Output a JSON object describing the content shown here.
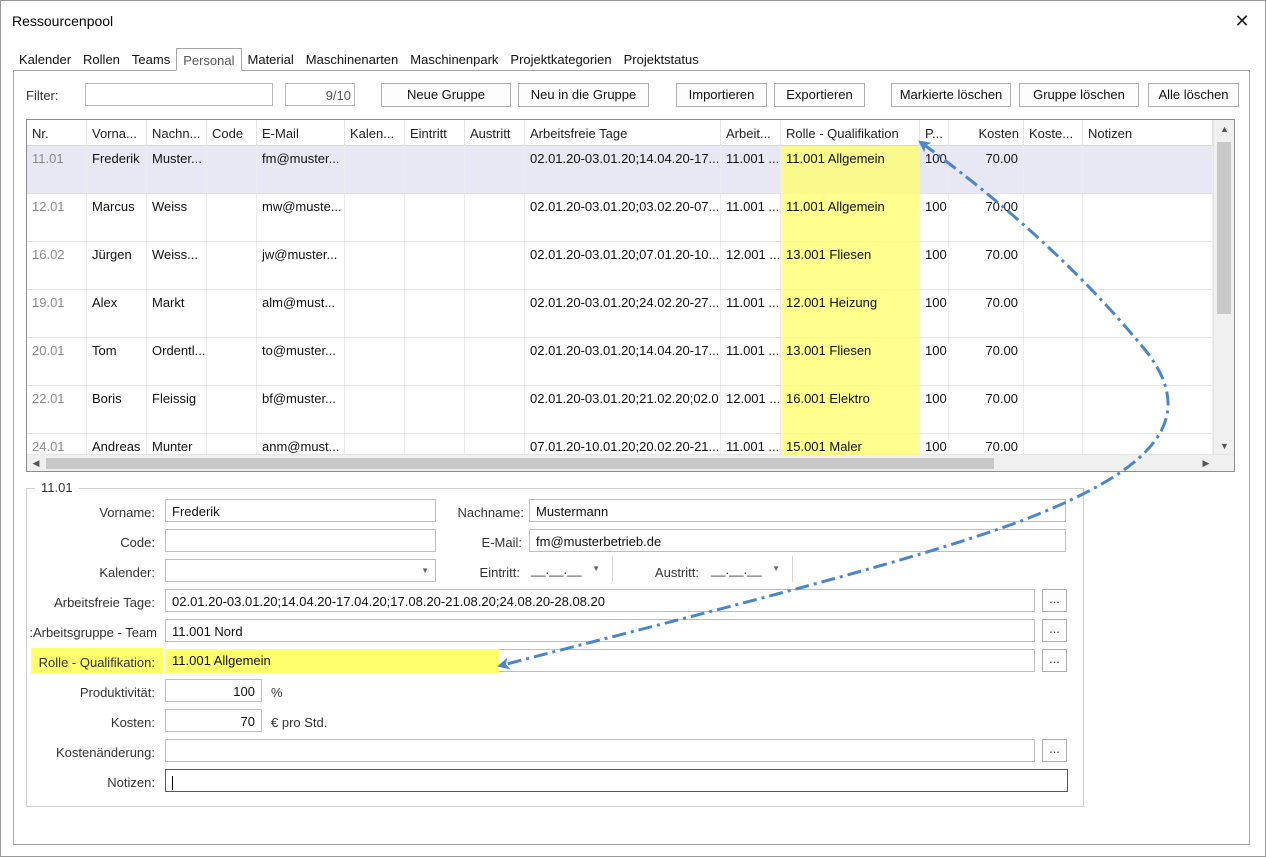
{
  "window": {
    "title": "Ressourcenpool",
    "close_glyph": "✕"
  },
  "tabs": [
    {
      "label": "Kalender"
    },
    {
      "label": "Rollen"
    },
    {
      "label": "Teams"
    },
    {
      "label": "Personal"
    },
    {
      "label": "Material"
    },
    {
      "label": "Maschinenarten"
    },
    {
      "label": "Maschinenpark"
    },
    {
      "label": "Projektkategorien"
    },
    {
      "label": "Projektstatus"
    }
  ],
  "active_tab": "Personal",
  "toolbar": {
    "filter_label": "Filter:",
    "filter_value": "",
    "counter": "9/10",
    "buttons": {
      "new_group": "Neue Gruppe",
      "new_in_group": "Neu in die Gruppe",
      "import": "Importieren",
      "export": "Exportieren",
      "delete_marked": "Markierte löschen",
      "delete_group": "Gruppe löschen",
      "delete_all": "Alle löschen"
    }
  },
  "grid": {
    "columns": [
      "Nr.",
      "Vorna...",
      "Nachn...",
      "Code",
      "E-Mail",
      "Kalen...",
      "Eintritt",
      "Austritt",
      "Arbeitsfreie Tage",
      "Arbeit...",
      "Rolle - Qualifikation",
      "P...",
      "Kosten",
      "Koste...",
      "Notizen"
    ],
    "rows": [
      [
        "11.01",
        "Frederik",
        "Muster...",
        "",
        "fm@muster...",
        "",
        "",
        "",
        "02.01.20-03.01.20;14.04.20-17....",
        "11.001 ...",
        "11.001 Allgemein",
        "100",
        "70.00",
        "",
        ""
      ],
      [
        "12.01",
        "Marcus",
        "Weiss",
        "",
        "mw@muste...",
        "",
        "",
        "",
        "02.01.20-03.01.20;03.02.20-07....",
        "11.001 ...",
        "11.001 Allgemein",
        "100",
        "70.00",
        "",
        ""
      ],
      [
        "16.02",
        "Jürgen",
        "Weiss...",
        "",
        "jw@muster...",
        "",
        "",
        "",
        "02.01.20-03.01.20;07.01.20-10....",
        "12.001 ...",
        "13.001 Fliesen",
        "100",
        "70.00",
        "",
        ""
      ],
      [
        "19.01",
        "Alex",
        "Markt",
        "",
        "alm@must...",
        "",
        "",
        "",
        "02.01.20-03.01.20;24.02.20-27....",
        "11.001 ...",
        "12.001 Heizung",
        "100",
        "70.00",
        "",
        ""
      ],
      [
        "20.01",
        "Tom",
        "Ordentl...",
        "",
        "to@muster...",
        "",
        "",
        "",
        "02.01.20-03.01.20;14.04.20-17....",
        "11.001 ...",
        "13.001 Fliesen",
        "100",
        "70.00",
        "",
        ""
      ],
      [
        "22.01",
        "Boris",
        "Fleissig",
        "",
        "bf@muster...",
        "",
        "",
        "",
        "02.01.20-03.01.20;21.02.20;02.0...",
        "12.001 ...",
        "16.001 Elektro",
        "100",
        "70.00",
        "",
        ""
      ],
      [
        "24.01",
        "Andreas",
        "Munter",
        "",
        "anm@must...",
        "",
        "",
        "",
        "07.01.20-10.01.20;20.02.20-21....",
        "11.001 ...",
        "15.001 Maler",
        "100",
        "70.00",
        "",
        ""
      ]
    ],
    "selected_row": 0
  },
  "detail": {
    "group_title": "11.01",
    "labels": {
      "vorname": "Vorname:",
      "nachname": "Nachname:",
      "code": "Code:",
      "email": "E-Mail:",
      "kalender": "Kalender:",
      "eintritt": "Eintritt:",
      "austritt": "Austritt:",
      "arbeitsfreie_tage": "Arbeitsfreie Tage:",
      "arbeitsgruppe": "Arbeitsgruppe - Team:",
      "rolle": "Rolle - Qualifikation:",
      "produktivitaet": "Produktivität:",
      "kosten": "Kosten:",
      "kostenaenderung": "Kostenänderung:",
      "notizen": "Notizen:"
    },
    "values": {
      "vorname": "Frederik",
      "nachname": "Mustermann",
      "code": "",
      "email": "fm@musterbetrieb.de",
      "kalender": "",
      "eintritt": "__.__.__",
      "austritt": "__.__.__",
      "arbeitsfreie_tage": "02.01.20-03.01.20;14.04.20-17.04.20;17.08.20-21.08.20;24.08.20-28.08.20",
      "arbeitsgruppe": "11.001 Nord",
      "rolle": "11.001 Allgemein",
      "produktivitaet": "100",
      "kosten": "70",
      "kostenaenderung": "",
      "notizen": ""
    },
    "units": {
      "produktivitaet": "%",
      "kosten": "€ pro Std."
    },
    "ellipsis": "..."
  },
  "colors": {
    "highlight": "#ffff6e",
    "arrow": "#4a86c8",
    "selected_row": "#e8e8f5"
  }
}
